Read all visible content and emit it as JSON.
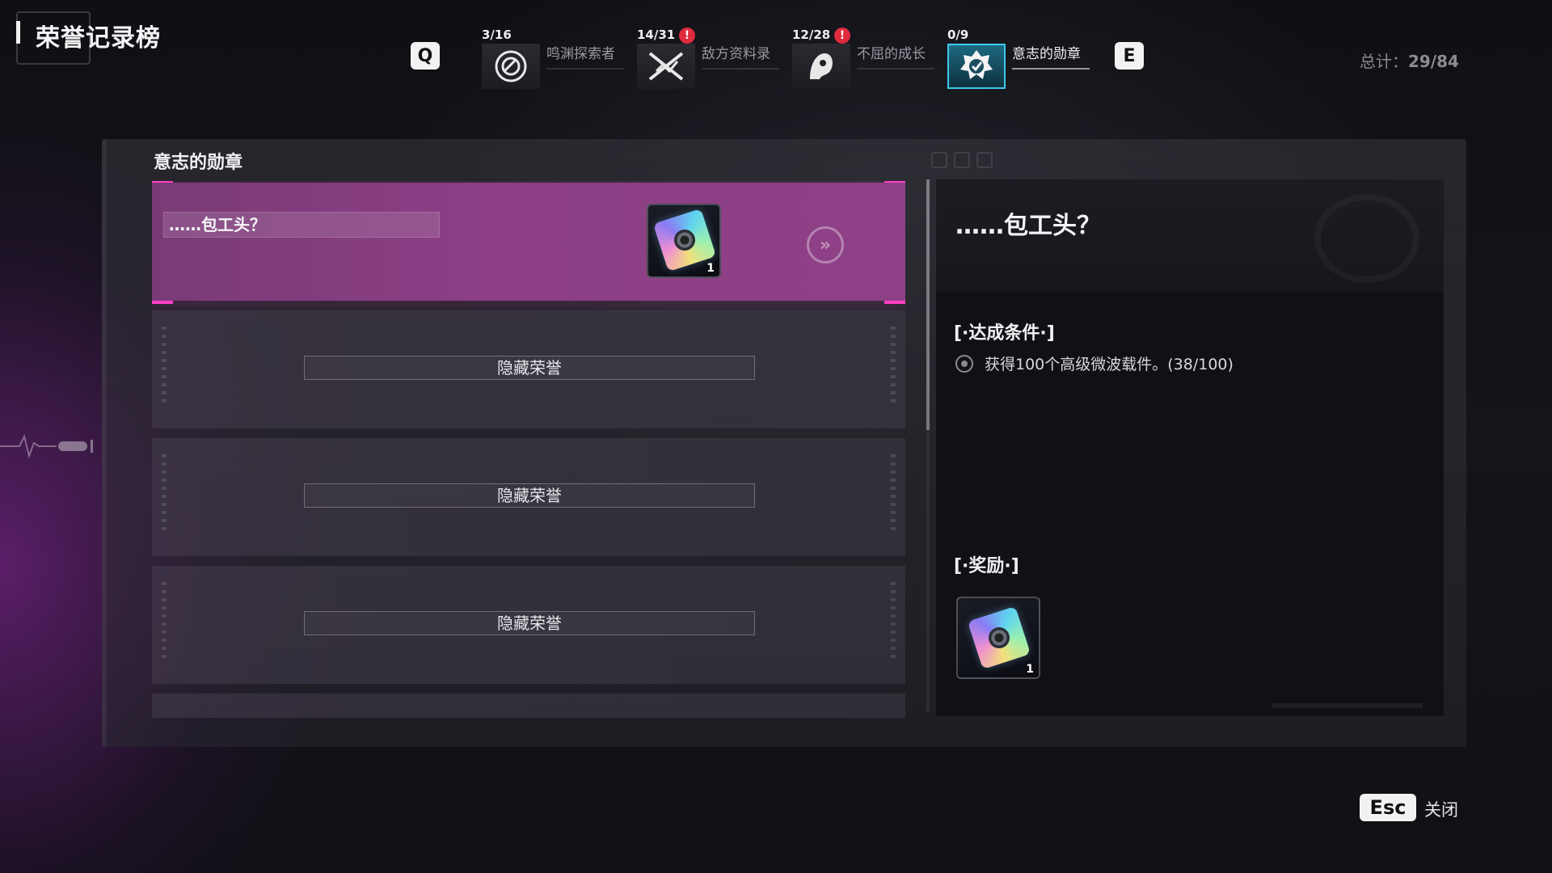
{
  "header": {
    "title": "荣誉记录榜",
    "prev_key": "Q",
    "next_key": "E",
    "total_label": "总计：",
    "total_value": "29/84"
  },
  "categories": [
    {
      "count": "3/16",
      "label": "鸣渊探索者",
      "icon": "abyss-explorer-icon",
      "alert": false,
      "active": false
    },
    {
      "count": "14/31",
      "label": "敌方资料录",
      "icon": "enemy-records-icon",
      "alert": true,
      "active": false
    },
    {
      "count": "12/28",
      "label": "不屈的成长",
      "icon": "unyielding-growth-icon",
      "alert": true,
      "active": false
    },
    {
      "count": "0/9",
      "label": "意志的勋章",
      "icon": "will-medal-icon",
      "alert": false,
      "active": true
    }
  ],
  "alert_glyph": "!",
  "list": {
    "section_title": "意志的勋章",
    "items": [
      {
        "name": "……包工头？",
        "selected": true,
        "reward_qty": "1",
        "reward_icon": "microwave-carrier-icon"
      },
      {
        "name": "隐藏荣誉",
        "hidden": true
      },
      {
        "name": "隐藏荣誉",
        "hidden": true
      },
      {
        "name": "隐藏荣誉",
        "hidden": true
      }
    ],
    "goto_glyph": "»"
  },
  "detail": {
    "title": "……包工头？",
    "condition_heading": "[·达成条件·]",
    "condition_text": "获得100个高级微波载件。(38/100)",
    "reward_heading": "[·奖励·]",
    "reward_qty": "1",
    "reward_icon": "microwave-carrier-icon"
  },
  "footer": {
    "close_key": "Esc",
    "close_label": "关闭"
  },
  "colors": {
    "selected_accent": "#ff3fc6",
    "selected_fill": "#8c3f85",
    "active_tab": "#3ec9ea",
    "alert": "#e02a3e"
  }
}
